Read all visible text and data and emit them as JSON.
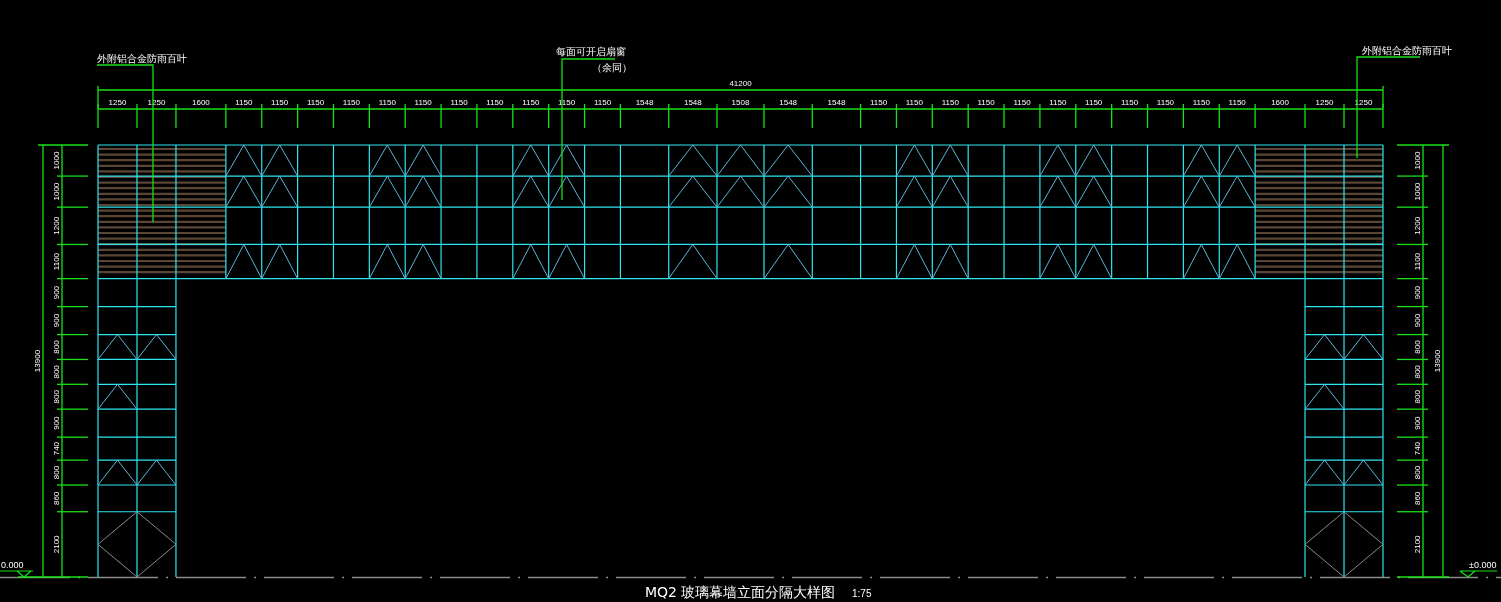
{
  "drawing": {
    "title": "MQ2 玻璃幕墙立面分隔大样图",
    "scale": "1:75",
    "annotations": [
      {
        "text": "外附铝合金防雨百叶"
      },
      {
        "text": "每面可开启扇窗",
        "note": "（余同）"
      },
      {
        "text": "外附铝合金防雨百叶"
      }
    ],
    "top_dimension_total": "41200",
    "top_dimensions": [
      "1250",
      "1250",
      "1600",
      "1150",
      "1150",
      "1150",
      "1150",
      "1150",
      "1150",
      "1150",
      "1150",
      "1150",
      "1150",
      "1150",
      "1548",
      "1548",
      "1508",
      "1548",
      "1548",
      "1150",
      "1150",
      "1150",
      "1150",
      "1150",
      "1150",
      "1150",
      "1150",
      "1150",
      "1150",
      "1150",
      "1600",
      "1250",
      "1250"
    ],
    "left_dimension_total": "13900",
    "left_dimensions": [
      "1000",
      "1000",
      "1200",
      "1100",
      "900",
      "900",
      "800",
      "800",
      "800",
      "900",
      "740",
      "800",
      "860",
      "2100"
    ],
    "right_dimension_total": "13900",
    "right_dimensions": [
      "1000",
      "1000",
      "1200",
      "1100",
      "900",
      "900",
      "800",
      "800",
      "800",
      "900",
      "740",
      "800",
      "860",
      "2100"
    ],
    "left_level": "0.000",
    "right_level": "±0.000"
  }
}
